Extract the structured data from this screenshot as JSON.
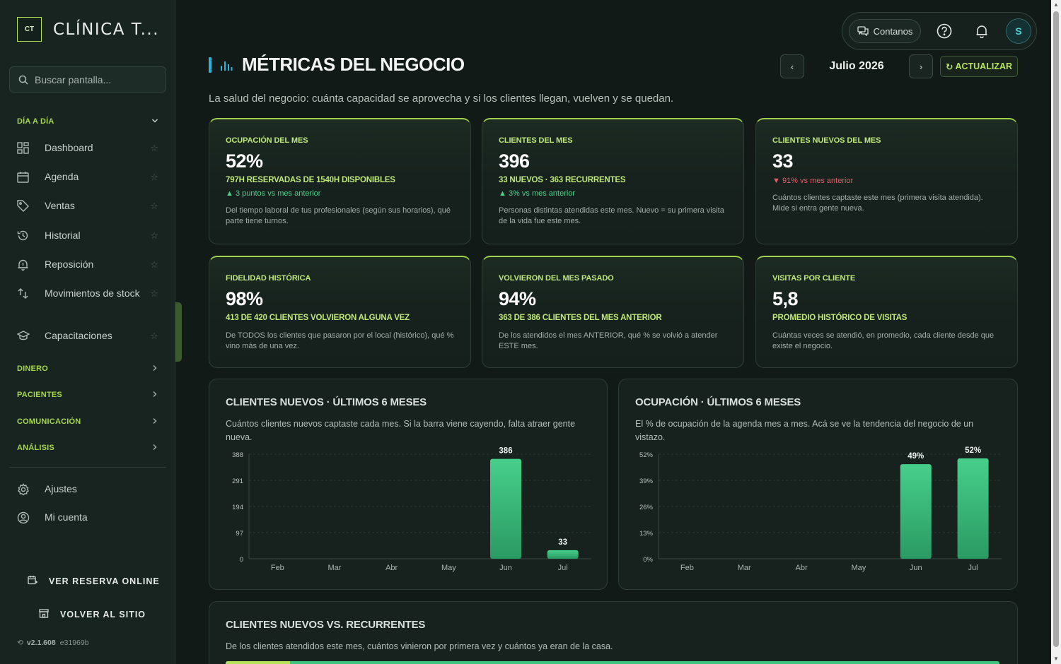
{
  "brand": {
    "logo": "CT",
    "name": "CLÍNICA T..."
  },
  "search": {
    "placeholder": "Buscar pantalla..."
  },
  "sidebar": {
    "section_daily": "DÍA A DÍA",
    "items": [
      {
        "label": "Dashboard",
        "icon": "dashboard-icon"
      },
      {
        "label": "Agenda",
        "icon": "calendar-icon"
      },
      {
        "label": "Ventas",
        "icon": "tag-icon"
      },
      {
        "label": "Historial",
        "icon": "history-icon"
      },
      {
        "label": "Reposición",
        "icon": "bell-icon"
      },
      {
        "label": "Movimientos de stock",
        "icon": "swap-arrows-icon"
      },
      {
        "label": "Capacitaciones",
        "icon": "graduation-cap-icon"
      }
    ],
    "sections": [
      "DINERO",
      "PACIENTES",
      "COMUNICACIÓN",
      "ANÁLISIS"
    ],
    "settings": "Ajustes",
    "account": "Mi cuenta",
    "online_booking": "VER RESERVA ONLINE",
    "back_to_site": "VOLVER AL SITIO",
    "version": "v2.1.608",
    "commit": "e31969b"
  },
  "topbar": {
    "contact": "Contanos",
    "avatar_initial": "S"
  },
  "header": {
    "title": "MÉTRICAS DEL NEGOCIO",
    "month": "Julio 2026",
    "prev": "‹",
    "next": "›",
    "refresh": "ACTUALIZAR",
    "subtitle": "La salud del negocio: cuánta capacidad se aprovecha y si los clientes llegan, vuelven y se quedan."
  },
  "kpis": [
    {
      "label": "OCUPACIÓN DEL MES",
      "value": "52%",
      "detail": "797H RESERVADAS DE 1540H DISPONIBLES",
      "trend": "▲ 3 puntos vs mes anterior",
      "trend_dir": "up",
      "desc": "Del tiempo laboral de tus profesionales (según sus horarios), qué parte tiene turnos."
    },
    {
      "label": "CLIENTES DEL MES",
      "value": "396",
      "detail": "33 NUEVOS · 363 RECURRENTES",
      "trend": "▲ 3% vs mes anterior",
      "trend_dir": "up",
      "desc": "Personas distintas atendidas este mes. Nuevo = su primera visita de la vida fue este mes."
    },
    {
      "label": "CLIENTES NUEVOS DEL MES",
      "value": "33",
      "detail": "",
      "trend": "▼ 91% vs mes anterior",
      "trend_dir": "down",
      "desc": "Cuántos clientes captaste este mes (primera visita atendida). Mide si entra gente nueva."
    },
    {
      "label": "FIDELIDAD HISTÓRICA",
      "value": "98%",
      "detail": "413 DE 420 CLIENTES VOLVIERON ALGUNA VEZ",
      "trend": "",
      "trend_dir": "",
      "desc": "De TODOS los clientes que pasaron por el local (histórico), qué % vino más de una vez."
    },
    {
      "label": "VOLVIERON DEL MES PASADO",
      "value": "94%",
      "detail": "363 DE 386 CLIENTES DEL MES ANTERIOR",
      "trend": "",
      "trend_dir": "",
      "desc": "De los atendidos el mes ANTERIOR, qué % se volvió a atender ESTE mes."
    },
    {
      "label": "VISITAS POR CLIENTE",
      "value": "5,8",
      "detail": "PROMEDIO HISTÓRICO DE VISITAS",
      "trend": "",
      "trend_dir": "",
      "desc": "Cuántas veces se atendió, en promedio, cada cliente desde que existe el negocio."
    }
  ],
  "chart_data": [
    {
      "type": "bar",
      "title": "CLIENTES NUEVOS · ÚLTIMOS 6 MESES",
      "subtitle": "Cuántos clientes nuevos captaste cada mes. Si la barra viene cayendo, falta atraer gente nueva.",
      "categories": [
        "Feb",
        "Mar",
        "Abr",
        "May",
        "Jun",
        "Jul"
      ],
      "values": [
        0,
        0,
        0,
        0,
        386,
        33
      ],
      "data_labels": [
        "",
        "",
        "",
        "",
        "386",
        "33"
      ],
      "yticks": [
        "388",
        "291",
        "194",
        "97",
        "0"
      ],
      "ylim": [
        0,
        388
      ],
      "grid": true,
      "bar_color": "#3ec47f"
    },
    {
      "type": "bar",
      "title": "OCUPACIÓN · ÚLTIMOS 6 MESES",
      "subtitle": "El % de ocupación de la agenda mes a mes. Acá se ve la tendencia del negocio de un vistazo.",
      "categories": [
        "Feb",
        "Mar",
        "Abr",
        "May",
        "Jun",
        "Jul"
      ],
      "values": [
        0,
        0,
        0,
        0,
        49,
        52
      ],
      "data_labels": [
        "",
        "",
        "",
        "",
        "49%",
        "52%"
      ],
      "yticks": [
        "52%",
        "39%",
        "26%",
        "13%",
        "0%"
      ],
      "ylim": [
        0,
        52
      ],
      "grid": true,
      "bar_color": "#3ec47f"
    }
  ],
  "bottom": {
    "title": "CLIENTES NUEVOS VS. RECURRENTES",
    "desc": "De los clientes atendidos este mes, cuántos vinieron por primera vez y cuántos ya eran de la casa.",
    "new_count": 33,
    "returning_count": 363
  },
  "colors": {
    "accent": "#b6e35a",
    "bar": "#3ec47f",
    "trend_up": "#4fce8a",
    "trend_down": "#e45d6a",
    "title_bar": "#2fb0d6"
  }
}
